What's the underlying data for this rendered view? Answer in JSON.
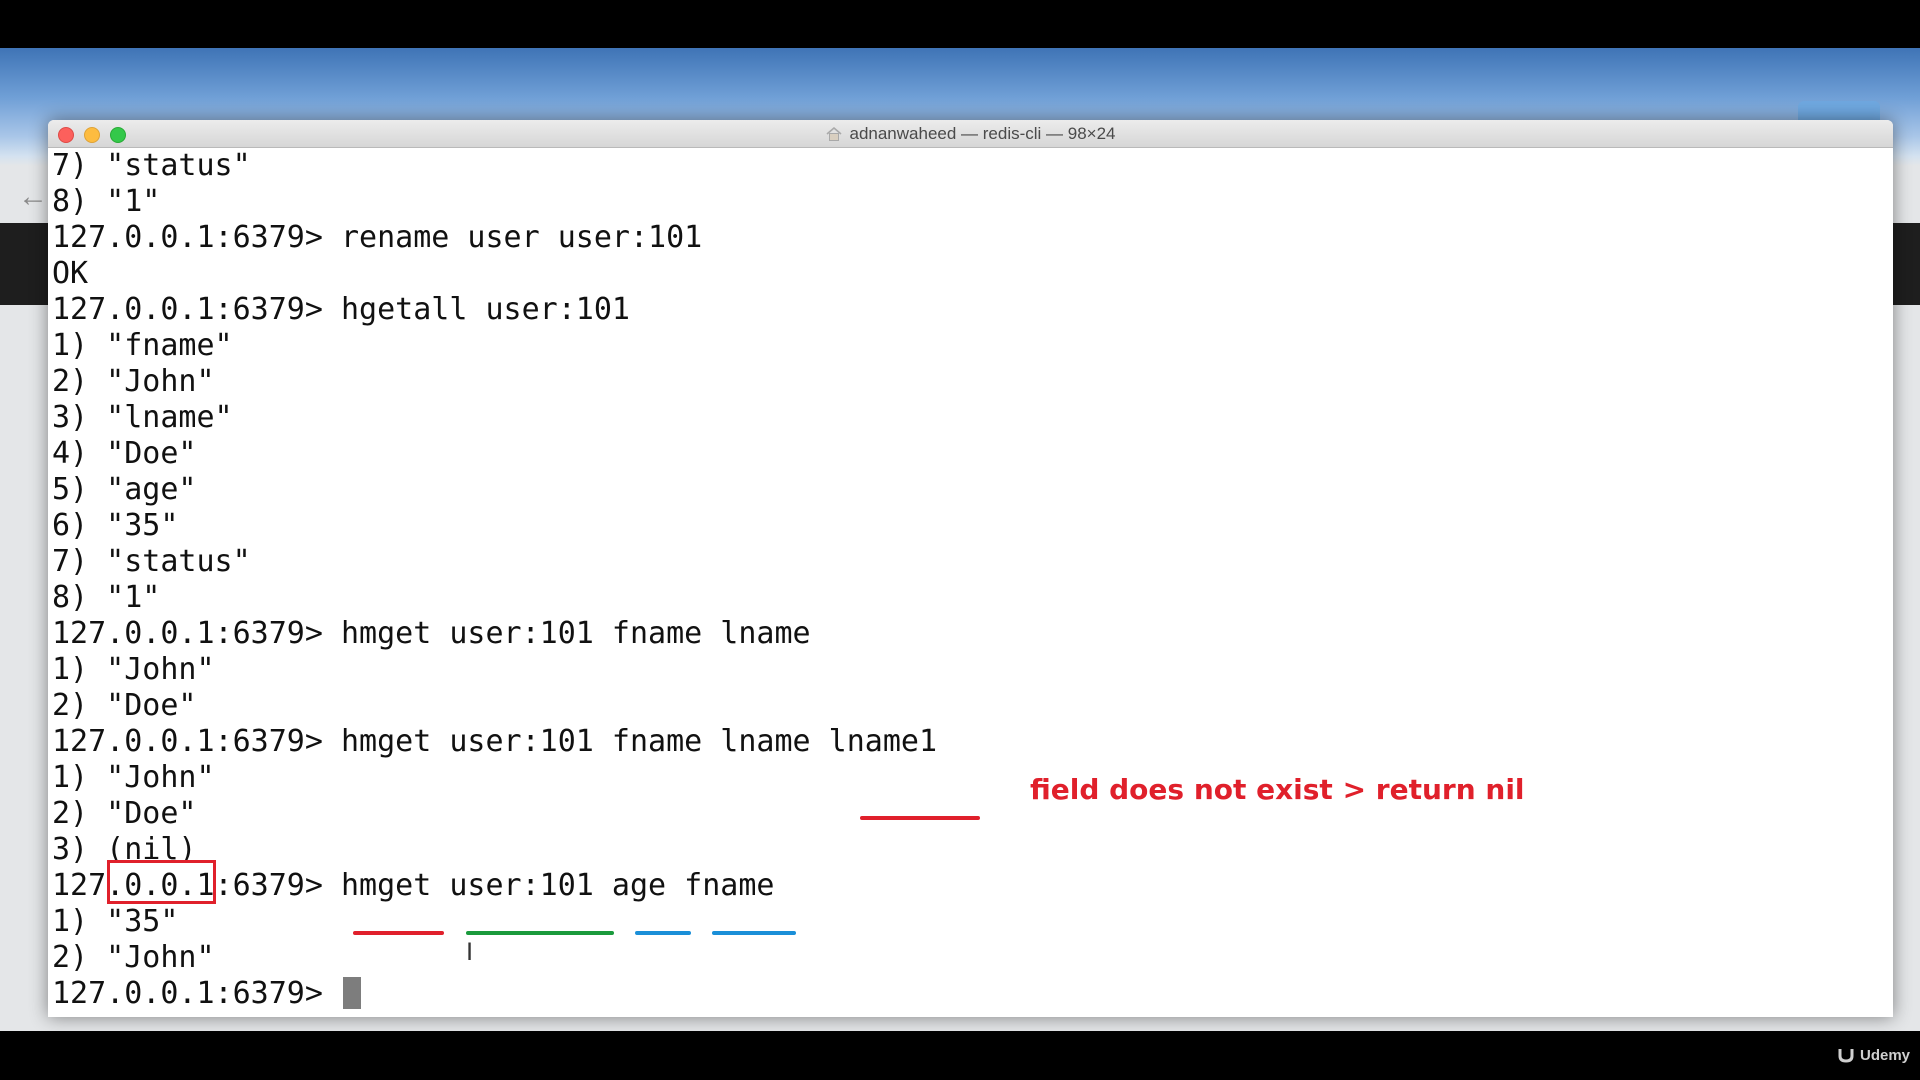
{
  "window": {
    "title": "adnanwaheed — redis-cli — 98×24"
  },
  "terminal": {
    "lines": [
      "7) \"status\"",
      "8) \"1\"",
      "127.0.0.1:6379> rename user user:101",
      "OK",
      "127.0.0.1:6379> hgetall user:101",
      "1) \"fname\"",
      "2) \"John\"",
      "3) \"lname\"",
      "4) \"Doe\"",
      "5) \"age\"",
      "6) \"35\"",
      "7) \"status\"",
      "8) \"1\"",
      "127.0.0.1:6379> hmget user:101 fname lname",
      "1) \"John\"",
      "2) \"Doe\"",
      "127.0.0.1:6379> hmget user:101 fname lname lname1",
      "1) \"John\"",
      "2) \"Doe\"",
      "3) (nil)",
      "127.0.0.1:6379> hmget user:101 age fname",
      "1) \"35\"",
      "2) \"John\"",
      "127.0.0.1:6379> "
    ]
  },
  "annotation": {
    "text": "field does not exist > return nil",
    "color": "#e0202b",
    "underline_colors": {
      "command": "#e0202b",
      "key": "#1a9a3c",
      "fields": "#1a8fd8"
    }
  },
  "watermark": {
    "brand": "Udemy"
  }
}
